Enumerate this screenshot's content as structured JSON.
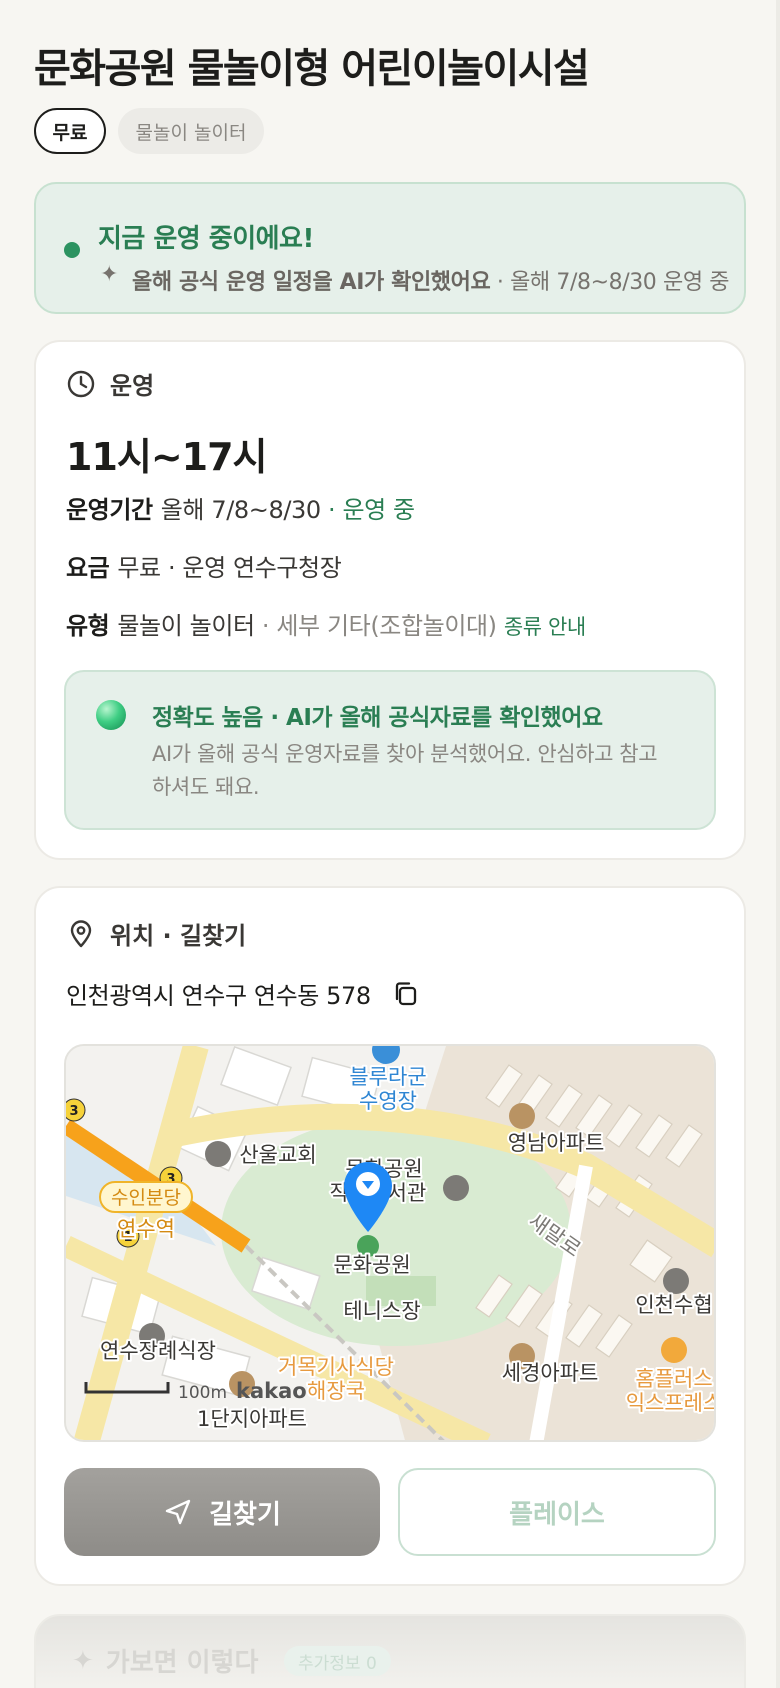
{
  "header": {
    "title": "문화공원 물놀이형 어린이놀이시설",
    "chips": {
      "free": "무료",
      "type": "물놀이 놀이터"
    }
  },
  "status_banner": {
    "title": "지금 운영 중이에요!",
    "sub_bold": "올해 공식 운영 일정을 AI가 확인했어요",
    "sub_rest": " · 올해 7/8~8/30 운영 중",
    "color": "#2a7e53"
  },
  "operation": {
    "heading": "운영",
    "hours": "11시~17시",
    "period_label": "운영기간",
    "period_value": "올해 7/8~8/30",
    "period_status": " · 운영 중",
    "fee_label": "요금",
    "fee_value": "무료 · 운영 연수구청장",
    "type_label": "유형",
    "type_value": "물놀이 놀이터",
    "type_detail": " · 세부 기타(조합놀이대)",
    "type_link": "종류 안내",
    "ai": {
      "title": "정확도 높음 · AI가 올해 공식자료를 확인했어요",
      "desc": "AI가 올해 공식 운영자료를 찾아 분석했어요. 안심하고 참고하셔도 돼요."
    }
  },
  "location": {
    "heading": "위치 · 길찾기",
    "address": "인천광역시 연수구 연수동 578",
    "map_labels": {
      "pool1": "블루라군",
      "pool2": "수영장",
      "church": "산울교회",
      "apt1": "영남아파트",
      "park_lib1": "문화공원",
      "park_lib2": "작은도서관",
      "park": "문화공원",
      "station1": "수인분당",
      "station2": "연수역",
      "road": "새말로",
      "tennis": "테니스장",
      "funeral": "연수장례식장",
      "apt2": "세경아파트",
      "rest1": "거목기사식당",
      "rest2": "해장국",
      "shop1": "홈플러스",
      "shop2": "익스프레스",
      "office": "인천수협",
      "apt3": "1단지아파트",
      "scale": "100m",
      "brand": "kakao",
      "line_no": "3",
      "line_no2": "1"
    },
    "buttons": {
      "nav": "길찾기",
      "place": "플레이스"
    }
  },
  "next_section": {
    "title": "가보면 이렇다",
    "badge": "추가정보 0"
  }
}
